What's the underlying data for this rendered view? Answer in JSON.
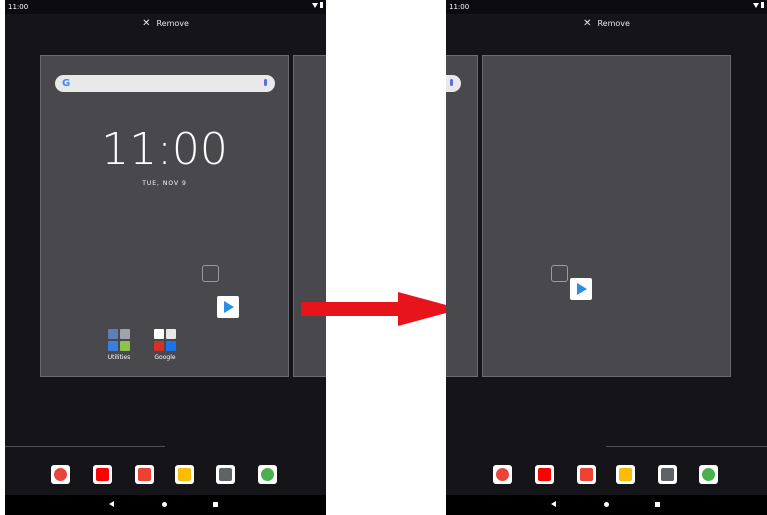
{
  "left": {
    "status_time": "11:00",
    "remove_label": "Remove",
    "clock": "11:00",
    "date": "TUE, NOV 9",
    "folders": [
      {
        "label": "Utilities",
        "colors": [
          "#5f7fb6",
          "#a0a4aa",
          "#3b7ee0",
          "#8bc34a"
        ]
      },
      {
        "label": "Google",
        "colors": [
          "#e8453c",
          "#ffffff",
          "#d93025",
          "#1a73e8"
        ]
      }
    ],
    "search_icon": "google-g-icon",
    "play_icon": "play-store-icon"
  },
  "right": {
    "status_time": "11:00",
    "remove_label": "Remove"
  },
  "dock_apps": [
    {
      "name": "chrome-icon",
      "color": "#e8453c"
    },
    {
      "name": "youtube-icon",
      "color": "#ff0000"
    },
    {
      "name": "gmail-icon",
      "color": "#ea4335"
    },
    {
      "name": "photos-icon",
      "color": "#fbbc04"
    },
    {
      "name": "camera-icon",
      "color": "#5f6368"
    },
    {
      "name": "settings-icon",
      "color": "#4caf50"
    }
  ],
  "arrow_color": "#e8141c"
}
